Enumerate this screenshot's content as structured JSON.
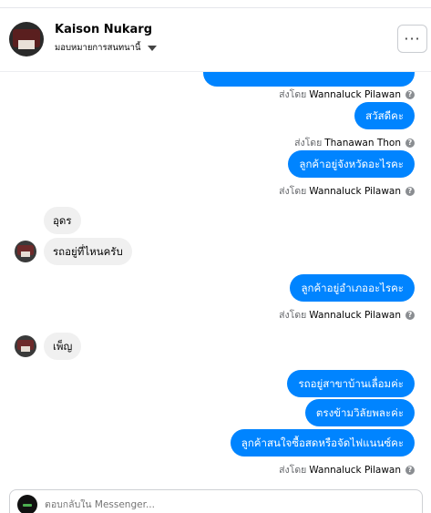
{
  "header": {
    "name": "Kaison Nukarg",
    "assign_label": "มอบหมายการสนทนานี้",
    "more_label": "···"
  },
  "conversation": [
    {
      "type": "out",
      "text": "",
      "partial": true
    },
    {
      "type": "sent_by",
      "prefix": "ส่งโดย",
      "sender": "Wannaluck Pilawan"
    },
    {
      "type": "out",
      "text": "สวัสดีคะ"
    },
    {
      "type": "sent_by",
      "prefix": "ส่งโดย",
      "sender": "Thanawan Thon"
    },
    {
      "type": "out",
      "text": "ลูกค้าอยู่จังหวัดอะไรคะ"
    },
    {
      "type": "sent_by",
      "prefix": "ส่งโดย",
      "sender": "Wannaluck Pilawan"
    },
    {
      "type": "in",
      "text": "อุดร"
    },
    {
      "type": "in",
      "text": "รถอยู่ที่ไหนครับ"
    },
    {
      "type": "out",
      "text": "ลูกค้าอยู่อำเภออะไรคะ"
    },
    {
      "type": "sent_by",
      "prefix": "ส่งโดย",
      "sender": "Wannaluck Pilawan"
    },
    {
      "type": "in",
      "text": "เพ็ญ"
    },
    {
      "type": "out",
      "text": "รถอยู่สาขาบ้านเลื่อมค่ะ"
    },
    {
      "type": "out",
      "text": "ตรงข้ามวิลัยพละค่ะ"
    },
    {
      "type": "out",
      "text": "ลูกค้าสนใจซื้อสดหรือจัดไฟแนนซ์คะ"
    },
    {
      "type": "sent_by",
      "prefix": "ส่งโดย",
      "sender": "Wannaluck Pilawan"
    }
  ],
  "composer": {
    "placeholder": "ตอบกลับใน Messenger..."
  },
  "colors": {
    "outgoing_bubble": "#0084ff",
    "incoming_bubble": "#f0f0f0",
    "meta_text": "#65676b"
  }
}
